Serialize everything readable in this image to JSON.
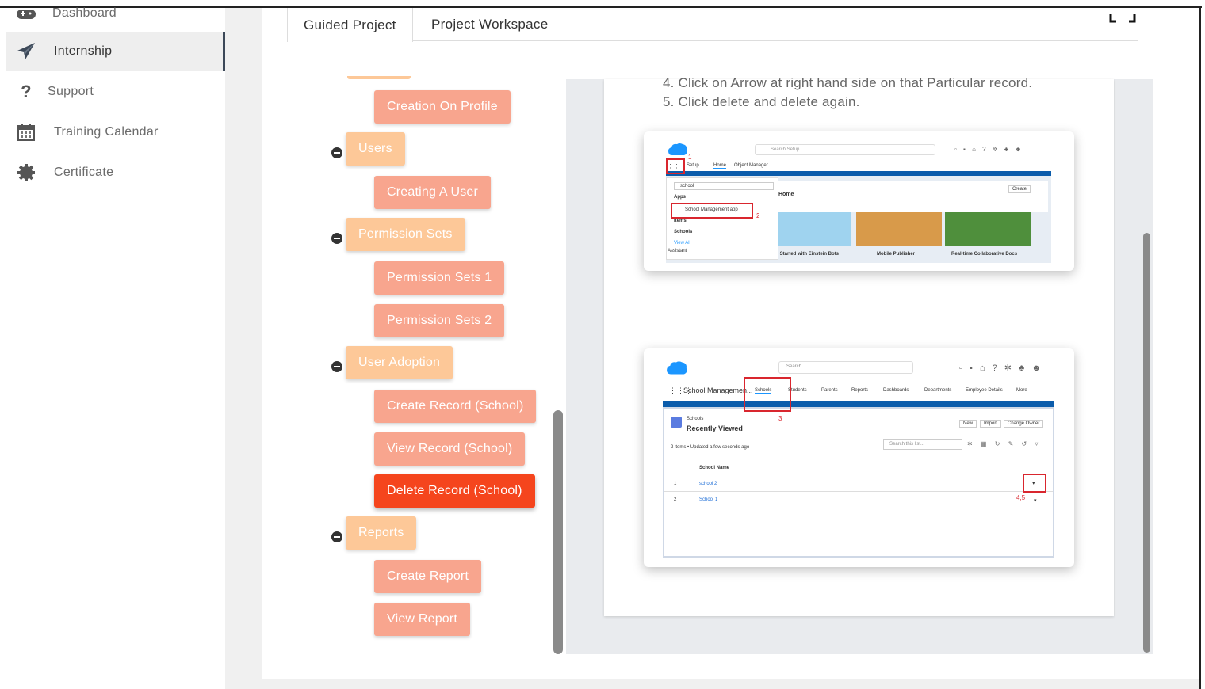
{
  "sidebar": {
    "items": [
      {
        "label": "Dashboard",
        "icon": "gamepad-icon"
      },
      {
        "label": "Internship",
        "icon": "paper-plane-icon",
        "active": true
      },
      {
        "label": "Support",
        "icon": "question-icon"
      },
      {
        "label": "Training Calendar",
        "icon": "calendar-icon"
      },
      {
        "label": "Certificate",
        "icon": "gear-badge-icon"
      }
    ]
  },
  "tabs": [
    {
      "label": "Guided Project",
      "active": true
    },
    {
      "label": "Project Workspace",
      "active": false
    }
  ],
  "tree": {
    "items": [
      {
        "label": "Creation On Profile",
        "level": 2
      },
      {
        "label": "Users",
        "level": 1
      },
      {
        "label": "Creating A User",
        "level": 2
      },
      {
        "label": "Permission Sets",
        "level": 1
      },
      {
        "label": "Permission Sets 1",
        "level": 2
      },
      {
        "label": "Permission Sets 2",
        "level": 2
      },
      {
        "label": "User Adoption",
        "level": 1
      },
      {
        "label": "Create Record (School)",
        "level": 2
      },
      {
        "label": "View Record (School)",
        "level": 2
      },
      {
        "label": "Delete Record (School)",
        "level": 2,
        "current": true
      },
      {
        "label": "Reports",
        "level": 1
      },
      {
        "label": "Create Report",
        "level": 2
      },
      {
        "label": "View Report",
        "level": 2
      }
    ]
  },
  "content": {
    "steps": [
      "4.  Click on Arrow at right hand side on that Particular record.",
      "5.  Click delete and delete again."
    ],
    "screenshot1": {
      "search_placeholder": "Search Setup",
      "nav_setup": "Setup",
      "nav_home": "Home",
      "nav_object_manager": "Object Manager",
      "search_value": "school",
      "apps_heading": "Apps",
      "app_result": "School Management app",
      "items_heading": "Items",
      "schools_item": "Schools",
      "view_all": "View All",
      "assistant": "Assistant",
      "home_title": "Home",
      "create_btn": "Create",
      "cards": [
        "Get Started with Einstein Bots",
        "Mobile Publisher",
        "Real-time Collaborative Docs"
      ],
      "markers": [
        "1",
        "2"
      ]
    },
    "screenshot2": {
      "search_placeholder": "Search...",
      "app_name": "School Managemen...",
      "tabs": [
        "Schools",
        "Students",
        "Parents",
        "Reports",
        "Dashboards",
        "Departments",
        "Employee Details",
        "More"
      ],
      "object_label": "Schools",
      "list_view": "Recently Viewed",
      "buttons": [
        "New",
        "Import",
        "Change Owner"
      ],
      "meta": "2 items • Updated a few seconds ago",
      "list_search": "Search this list...",
      "column": "School Name",
      "rows": [
        {
          "num": "1",
          "name": "school 2"
        },
        {
          "num": "2",
          "name": "School 1"
        }
      ],
      "markers": [
        "3",
        "4,5"
      ]
    }
  },
  "colors": {
    "level1": "#fdc898",
    "level2": "#f8a58e",
    "current": "#f5451d",
    "sf_blue": "#1b96ff",
    "marker_red": "#d9262e"
  }
}
